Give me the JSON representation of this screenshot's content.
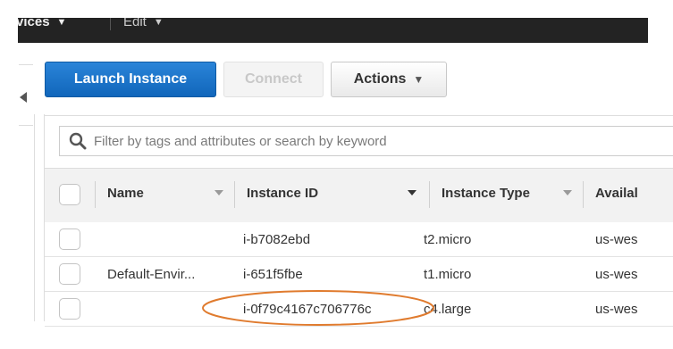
{
  "topnav": {
    "services_label": "vices",
    "edit_label": "Edit"
  },
  "toolbar": {
    "launch_label": "Launch Instance",
    "connect_label": "Connect",
    "actions_label": "Actions"
  },
  "search": {
    "placeholder": "Filter by tags and attributes or search by keyword"
  },
  "table": {
    "columns": {
      "name": "Name",
      "instance_id": "Instance ID",
      "instance_type": "Instance Type",
      "availability": "Availal"
    },
    "rows": [
      {
        "name": "",
        "instance_id": "i-b7082ebd",
        "instance_type": "t2.micro",
        "availability": "us-wes"
      },
      {
        "name": "Default-Envir...",
        "instance_id": "i-651f5fbe",
        "instance_type": "t1.micro",
        "availability": "us-wes"
      },
      {
        "name": "",
        "instance_id": "i-0f79c4167c706776c",
        "instance_type": "c4.large",
        "availability": "us-wes"
      }
    ]
  },
  "annotation": {
    "highlight_color": "#e07b2e"
  },
  "colors": {
    "primary": "#1a73c9",
    "topbar": "#232323"
  }
}
